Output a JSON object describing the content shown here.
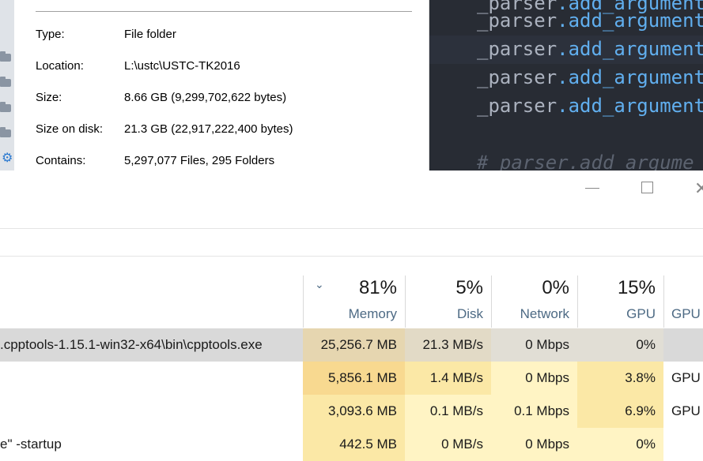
{
  "properties": {
    "rows": [
      {
        "label": "Type:",
        "value": "File folder"
      },
      {
        "label": "Location:",
        "value": "L:\\ustc\\USTC-TK2016"
      },
      {
        "label": "Size:",
        "value": "8.66 GB (9,299,702,622 bytes)"
      },
      {
        "label": "Size on disk:",
        "value": "21.3 GB (22,917,222,400 bytes)"
      },
      {
        "label": "Contains:",
        "value": "5,297,077 Files, 295 Folders"
      }
    ]
  },
  "editor": {
    "lines": [
      {
        "var": "_parser",
        "fn": ".add_argument"
      },
      {
        "var": "_parser",
        "fn": ".add_argument"
      },
      {
        "var": "_parser",
        "fn": ".add_argument"
      },
      {
        "var": "_parser",
        "fn": ".add_argument"
      },
      {
        "var": "_parser",
        "fn": ".add_argument"
      }
    ],
    "comment": "#  parser.add_argume"
  },
  "task_manager": {
    "columns": [
      {
        "pct": "81%",
        "name": "Memory"
      },
      {
        "pct": "5%",
        "name": "Disk"
      },
      {
        "pct": "0%",
        "name": "Network"
      },
      {
        "pct": "15%",
        "name": "GPU"
      },
      {
        "pct": "",
        "name": "GPU e"
      }
    ],
    "rows": [
      {
        "name": ".cpptools-1.15.1-win32-x64\\bin\\cpptools.exe",
        "memory": "25,256.7 MB",
        "disk": "21.3 MB/s",
        "network": "0 Mbps",
        "gpu": "0%",
        "gpu_engine": "",
        "selected": true
      },
      {
        "name": "",
        "memory": "5,856.1 MB",
        "disk": "1.4 MB/s",
        "network": "0 Mbps",
        "gpu": "3.8%",
        "gpu_engine": "GPU"
      },
      {
        "name": "",
        "memory": "3,093.6 MB",
        "disk": "0.1 MB/s",
        "network": "0.1 Mbps",
        "gpu": "6.9%",
        "gpu_engine": "GPU"
      },
      {
        "name": "e\" -startup",
        "memory": "442.5 MB",
        "disk": "0 MB/s",
        "network": "0 Mbps",
        "gpu": "0%",
        "gpu_engine": ""
      }
    ]
  },
  "colors": {
    "selected_row": "#d9d9d9",
    "memory_heat_high": "#f8d990",
    "memory_heat_mid": "#fbe8a6",
    "heat_low": "#fff4c4",
    "editor_bg": "#282c34",
    "editor_fn": "#61afef"
  }
}
